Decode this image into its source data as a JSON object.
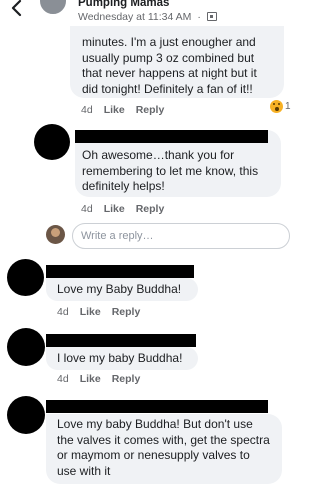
{
  "header": {
    "group_name": "Pumping Mamas",
    "post_meta": "Wednesday at 11:34 AM",
    "separator": "·"
  },
  "comments": [
    {
      "text": "minutes. I'm a just enougher and usually pump 3 oz combined but that never happens at night but it did tonight! Definitely a fan of it!!",
      "time": "4d",
      "like": "Like",
      "reply": "Reply",
      "reaction_count": "1"
    },
    {
      "text": "Oh awesome…thank you for remembering to let me know, this definitely helps!",
      "time": "4d",
      "like": "Like",
      "reply": "Reply"
    },
    {
      "text": "Love my Baby Buddha!",
      "time": "4d",
      "like": "Like",
      "reply": "Reply"
    },
    {
      "text": "I love my baby Buddha!",
      "time": "4d",
      "like": "Like",
      "reply": "Reply"
    },
    {
      "text": "Love my baby Buddha! But don't use the valves it comes with, get the spectra or maymom or nenesupply valves to use with it"
    }
  ],
  "reply_box": {
    "placeholder": "Write a reply…"
  },
  "icons": {
    "back": "chevron-left-icon",
    "audience": "group-audience-icon",
    "reaction": "wow-reaction-icon"
  },
  "colors": {
    "bubble": "#f0f2f5",
    "meta": "#65676b",
    "reaction": "#f7b125"
  }
}
